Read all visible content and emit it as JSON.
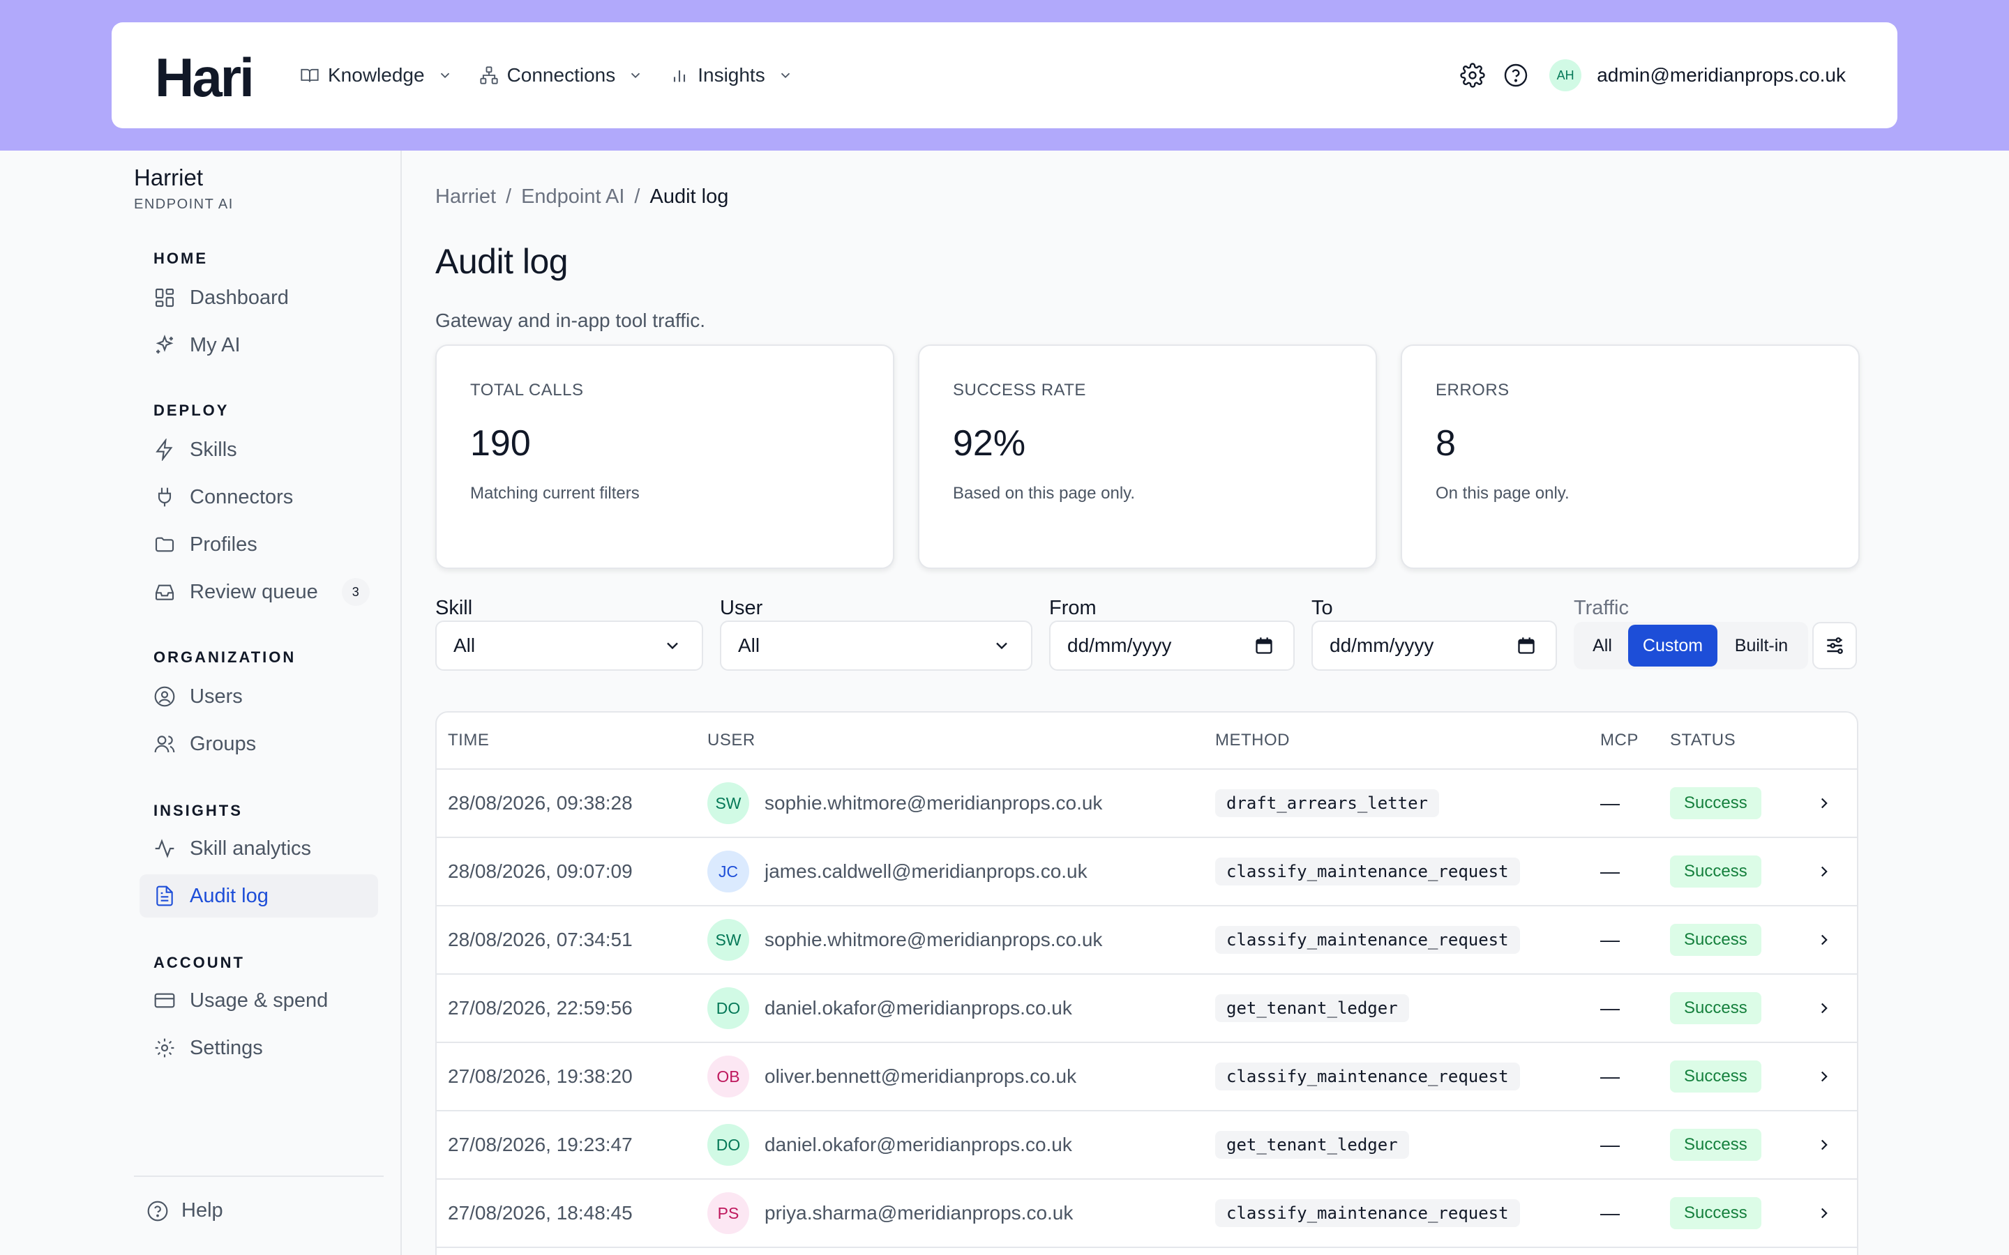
{
  "brand": {
    "logo": "Hari"
  },
  "nav": [
    {
      "label": "Knowledge",
      "icon": "book-icon"
    },
    {
      "label": "Connections",
      "icon": "network-icon"
    },
    {
      "label": "Insights",
      "icon": "bar-chart-icon"
    }
  ],
  "account": {
    "initials": "AH",
    "email": "admin@meridianprops.co.uk"
  },
  "sidebar": {
    "org_name": "Harriet",
    "org_sub": "ENDPOINT AI",
    "sections": {
      "home": "HOME",
      "deploy": "DEPLOY",
      "organization": "ORGANIZATION",
      "insights": "INSIGHTS",
      "account": "ACCOUNT"
    },
    "items": {
      "dashboard": "Dashboard",
      "my_ai": "My AI",
      "skills": "Skills",
      "connectors": "Connectors",
      "profiles": "Profiles",
      "review_queue": "Review queue",
      "review_queue_count": "3",
      "users": "Users",
      "groups": "Groups",
      "skill_analytics": "Skill analytics",
      "audit_log": "Audit log",
      "usage_spend": "Usage & spend",
      "settings": "Settings",
      "help": "Help"
    }
  },
  "breadcrumb": [
    "Harriet",
    "Endpoint AI",
    "Audit log"
  ],
  "page": {
    "title": "Audit log",
    "subtitle": "Gateway and in-app tool traffic."
  },
  "cards": [
    {
      "label": "TOTAL CALLS",
      "value": "190",
      "note": "Matching current filters"
    },
    {
      "label": "SUCCESS RATE",
      "value": "92%",
      "note": "Based on this page only."
    },
    {
      "label": "ERRORS",
      "value": "8",
      "note": "On this page only."
    }
  ],
  "filters": {
    "skill": {
      "label": "Skill",
      "value": "All"
    },
    "user": {
      "label": "User",
      "value": "All"
    },
    "from": {
      "label": "From",
      "placeholder": "dd/mm/yyyy"
    },
    "to": {
      "label": "To",
      "placeholder": "dd/mm/yyyy"
    },
    "traffic": {
      "label": "Traffic",
      "options": [
        "All",
        "Custom",
        "Built-in"
      ],
      "selected": "Custom"
    }
  },
  "table": {
    "headers": {
      "time": "TIME",
      "user": "USER",
      "method": "METHOD",
      "mcp": "MCP",
      "status": "STATUS"
    },
    "rows": [
      {
        "time": "28/08/2026, 09:38:28",
        "initials": "SW",
        "user": "sophie.whitmore@meridianprops.co.uk",
        "method": "draft_arrears_letter",
        "mcp": "—",
        "status": "Success",
        "avatar_bg": "#d1fae5",
        "avatar_fg": "#047857"
      },
      {
        "time": "28/08/2026, 09:07:09",
        "initials": "JC",
        "user": "james.caldwell@meridianprops.co.uk",
        "method": "classify_maintenance_request",
        "mcp": "—",
        "status": "Success",
        "avatar_bg": "#dbeafe",
        "avatar_fg": "#1d4ed8"
      },
      {
        "time": "28/08/2026, 07:34:51",
        "initials": "SW",
        "user": "sophie.whitmore@meridianprops.co.uk",
        "method": "classify_maintenance_request",
        "mcp": "—",
        "status": "Success",
        "avatar_bg": "#d1fae5",
        "avatar_fg": "#047857"
      },
      {
        "time": "27/08/2026, 22:59:56",
        "initials": "DO",
        "user": "daniel.okafor@meridianprops.co.uk",
        "method": "get_tenant_ledger",
        "mcp": "—",
        "status": "Success",
        "avatar_bg": "#d1fae5",
        "avatar_fg": "#047857"
      },
      {
        "time": "27/08/2026, 19:38:20",
        "initials": "OB",
        "user": "oliver.bennett@meridianprops.co.uk",
        "method": "classify_maintenance_request",
        "mcp": "—",
        "status": "Success",
        "avatar_bg": "#fce7f3",
        "avatar_fg": "#be185d"
      },
      {
        "time": "27/08/2026, 19:23:47",
        "initials": "DO",
        "user": "daniel.okafor@meridianprops.co.uk",
        "method": "get_tenant_ledger",
        "mcp": "—",
        "status": "Success",
        "avatar_bg": "#d1fae5",
        "avatar_fg": "#047857"
      },
      {
        "time": "27/08/2026, 18:48:45",
        "initials": "PS",
        "user": "priya.sharma@meridianprops.co.uk",
        "method": "classify_maintenance_request",
        "mcp": "—",
        "status": "Success",
        "avatar_bg": "#fce7f3",
        "avatar_fg": "#be185d"
      }
    ]
  }
}
